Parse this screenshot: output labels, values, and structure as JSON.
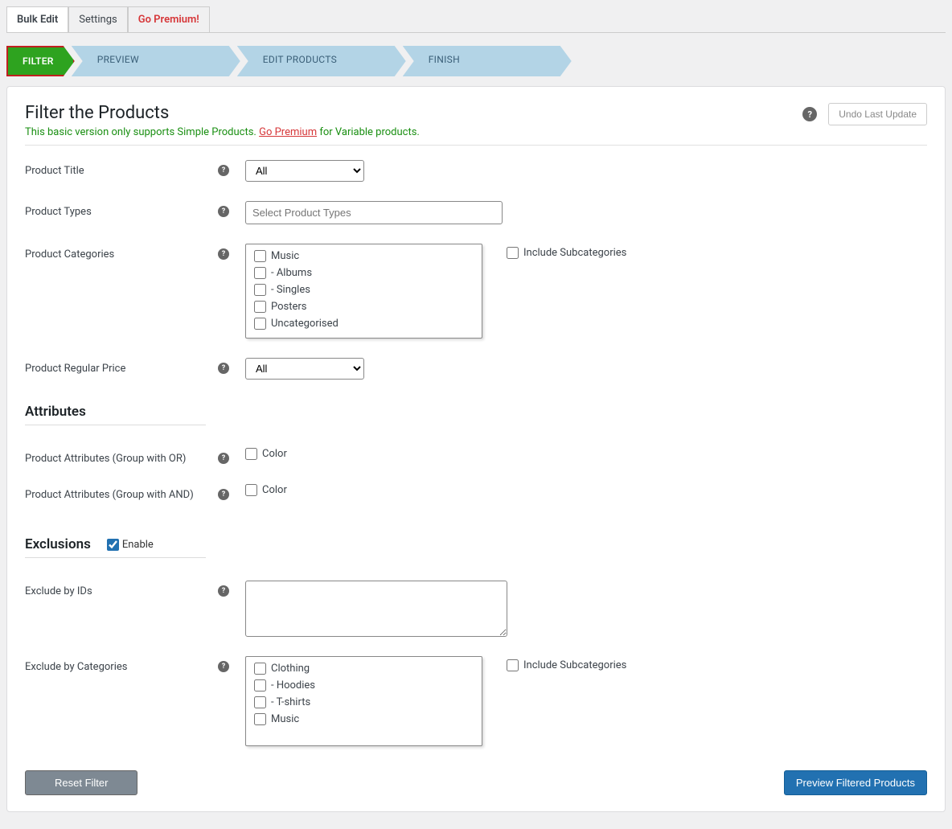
{
  "topTabs": {
    "bulkEdit": "Bulk Edit",
    "settings": "Settings",
    "premium": "Go Premium!"
  },
  "steps": {
    "filter": "FILTER",
    "preview": "PREVIEW",
    "edit": "EDIT PRODUCTS",
    "finish": "FINISH"
  },
  "header": {
    "title": "Filter the Products",
    "subtext1": "This basic version only supports Simple Products. ",
    "premiumLink": "Go Premium",
    "subtext2": " for Variable products.",
    "undo": "Undo Last Update"
  },
  "fields": {
    "productTitle": {
      "label": "Product Title",
      "value": "All"
    },
    "productTypes": {
      "label": "Product Types",
      "placeholder": "Select Product Types"
    },
    "productCategories": {
      "label": "Product Categories",
      "items": [
        "Music",
        "- Albums",
        "- Singles",
        "Posters",
        "Uncategorised"
      ],
      "includeSub": "Include Subcategories"
    },
    "regularPrice": {
      "label": "Product Regular Price",
      "value": "All"
    },
    "attributes": {
      "heading": "Attributes",
      "orLabel": "Product Attributes (Group with OR)",
      "andLabel": "Product Attributes (Group with AND)",
      "color": "Color"
    },
    "exclusions": {
      "heading": "Exclusions",
      "enable": "Enable",
      "byIds": "Exclude by IDs",
      "byCategories": "Exclude by Categories",
      "categories": [
        "Clothing",
        "- Hoodies",
        "- T-shirts",
        "Music"
      ],
      "includeSub": "Include Subcategories"
    }
  },
  "footer": {
    "reset": "Reset Filter",
    "preview": "Preview Filtered Products"
  }
}
